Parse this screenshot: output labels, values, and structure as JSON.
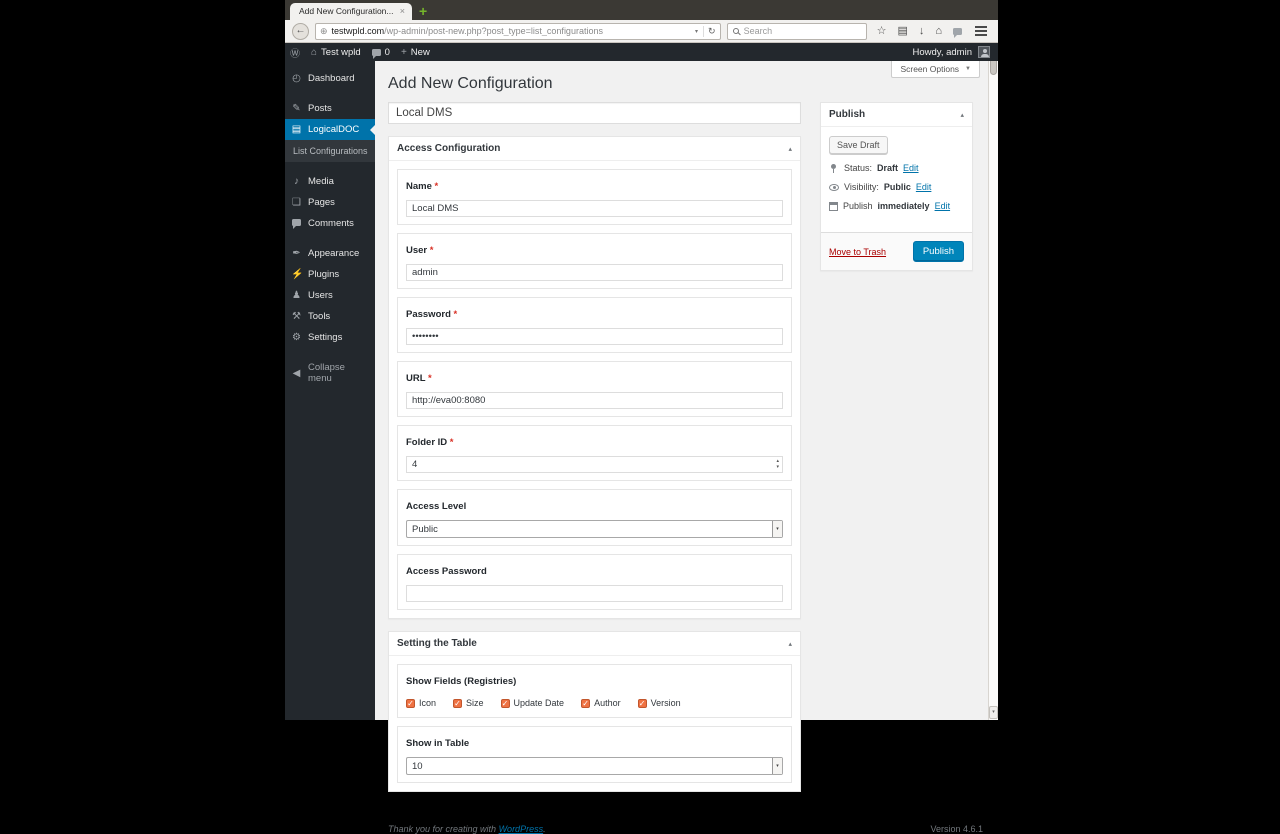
{
  "browser": {
    "tab": {
      "title": "Add New Configuration...",
      "close_glyph": "×",
      "new_tab_glyph": "+"
    },
    "toolbar": {
      "back_glyph": "←",
      "url_domain": "testwpld.com",
      "url_path": "/wp-admin/post-new.php?post_type=list_configurations",
      "url_caret_glyph": "▾",
      "reload_glyph": "↻",
      "site_icon_glyph": "⊕",
      "search_placeholder": "Search",
      "icons": {
        "bookmark_star": "☆",
        "bookmarks": "▤",
        "downloads": "↓",
        "home": "⌂"
      }
    }
  },
  "admin_bar": {
    "wp_logo_glyph": "Ⓦ",
    "home_glyph": "⌂",
    "site_name": "Test wpld",
    "comment_count": "0",
    "plus_glyph": "+",
    "new_label": "New",
    "howdy": "Howdy, admin"
  },
  "sidebar": {
    "items": [
      {
        "label": "Dashboard",
        "glyph": "◴"
      },
      {
        "label": "Posts",
        "glyph": "✎"
      },
      {
        "label": "LogicalDOC",
        "glyph": "▤"
      },
      {
        "label": "Media",
        "glyph": "♪"
      },
      {
        "label": "Pages",
        "glyph": "❏"
      },
      {
        "label": "Comments",
        "glyph": ""
      },
      {
        "label": "Appearance",
        "glyph": "✒"
      },
      {
        "label": "Plugins",
        "glyph": "⚡"
      },
      {
        "label": "Users",
        "glyph": "♟"
      },
      {
        "label": "Tools",
        "glyph": "⚒"
      },
      {
        "label": "Settings",
        "glyph": "⚙"
      },
      {
        "label": "Collapse menu",
        "glyph": "◀"
      }
    ],
    "submenu": {
      "label": "List Configurations"
    }
  },
  "content": {
    "screen_options": {
      "label": "Screen Options",
      "caret_glyph": "▼"
    },
    "page_title": "Add New Configuration",
    "title_input_value": "Local DMS",
    "access_box": {
      "title": "Access Configuration",
      "toggle_glyph": "▴",
      "fields": [
        {
          "label": "Name",
          "star": " *",
          "value": "Local DMS"
        },
        {
          "label": "User",
          "star": " *",
          "value": "admin"
        },
        {
          "label": "Password",
          "star": " *",
          "value": "••••••••"
        },
        {
          "label": "URL",
          "star": " *",
          "value": "http://eva00:8080"
        },
        {
          "label": "Folder ID",
          "star": " *",
          "value": "4"
        },
        {
          "label": "Access Level",
          "star": "",
          "value": "Public"
        },
        {
          "label": "Access Password",
          "star": "",
          "value": ""
        }
      ],
      "spinner_up_glyph": "▴",
      "spinner_down_glyph": "▾",
      "select_arrow_glyph": "▾"
    },
    "table_box": {
      "title": "Setting the Table",
      "toggle_glyph": "▴",
      "show_fields_label": "Show Fields (Registries)",
      "checkboxes": [
        {
          "label": "Icon",
          "checked": true
        },
        {
          "label": "Size",
          "checked": true
        },
        {
          "label": "Update Date",
          "checked": true
        },
        {
          "label": "Author",
          "checked": true
        },
        {
          "label": "Version",
          "checked": true
        }
      ],
      "show_in_table_label": "Show in Table",
      "show_in_table_value": "10",
      "select_arrow_glyph": "▾"
    },
    "footer": {
      "thanks": "Thank you for creating with ",
      "wordpress_link": "WordPress",
      "period": ".",
      "version": "Version 4.6.1"
    }
  },
  "publish_box": {
    "title": "Publish",
    "toggle_glyph": "▴",
    "save_draft": "Save Draft",
    "rows": [
      {
        "label": "Status:",
        "value": "Draft",
        "edit": "Edit"
      },
      {
        "label": "Visibility:",
        "value": "Public",
        "edit": "Edit"
      },
      {
        "label": "Publish",
        "value": "immediately",
        "edit": "Edit"
      }
    ],
    "move_to_trash": "Move to Trash",
    "publish": "Publish"
  },
  "scrollbar": {
    "down_glyph": "▾"
  },
  "colors": {
    "accent_blue": "#0073aa",
    "publish_button_blue": "#0085ba",
    "checkbox_orange": "#ef7243",
    "trash_red": "#a00000",
    "admin_dark": "#23282d",
    "submenu_dark": "#32373c",
    "content_bg": "#f1f1f1"
  }
}
